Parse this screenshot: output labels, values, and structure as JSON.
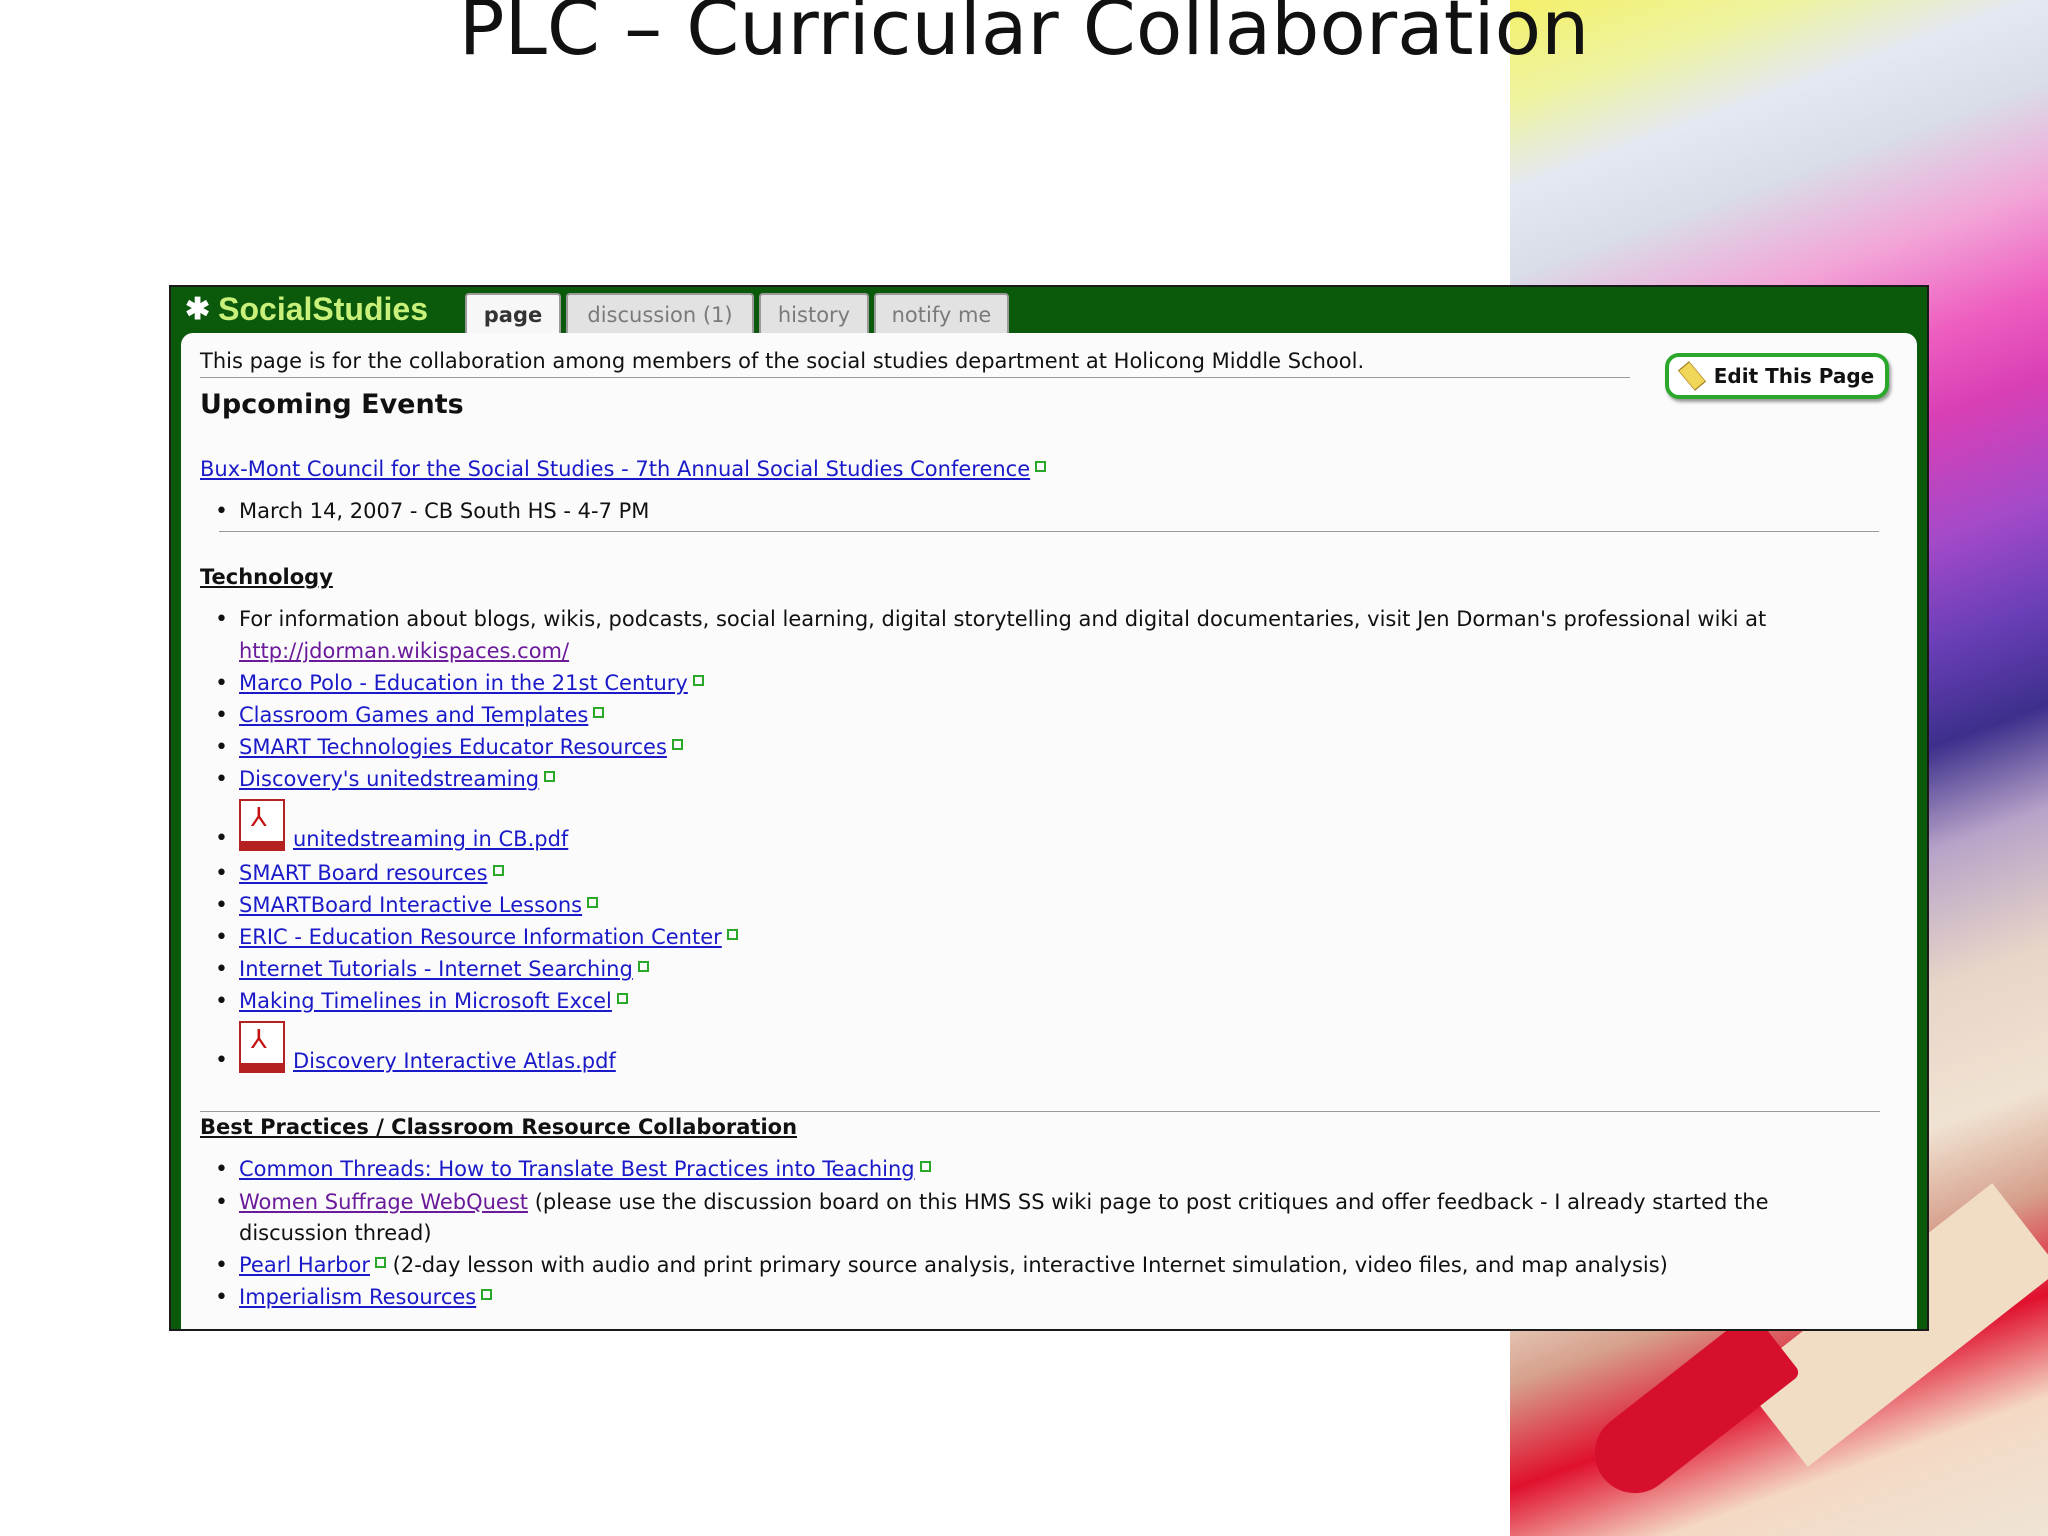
{
  "slide": {
    "title": "PLC – Curricular Collaboration"
  },
  "wiki": {
    "brand": "SocialStudies",
    "tabs": [
      "page",
      "discussion (1)",
      "history",
      "notify me"
    ],
    "edit_button": "Edit This Page",
    "intro": "This page is for the collaboration among members of the social studies department at Holicong Middle School.",
    "upcoming": {
      "heading": "Upcoming Events",
      "link": "Bux-Mont Council for the Social Studies - 7th Annual Social Studies Conference",
      "detail": "March 14, 2007 - CB South HS - 4-7 PM"
    },
    "technology": {
      "heading": "Technology",
      "info_text": "For information about blogs, wikis, podcasts, social learning, digital storytelling and digital documentaries, visit Jen Dorman's professional wiki at",
      "info_link": "http://jdorman.wikispaces.com/",
      "links": [
        "Marco Polo - Education in the 21st Century",
        "Classroom Games and Templates",
        "SMART Technologies Educator Resources",
        "Discovery's unitedstreaming",
        "unitedstreaming in CB.pdf",
        "SMART Board resources",
        "SMARTBoard Interactive Lessons",
        "ERIC - Education Resource Information Center",
        "Internet Tutorials - Internet Searching",
        "Making Timelines in Microsoft Excel",
        "Discovery Interactive Atlas.pdf"
      ]
    },
    "best": {
      "heading": "Best Practices / Classroom Resource Collaboration",
      "item1": "Common Threads: How to Translate Best Practices into Teaching",
      "item2_link": "Women Suffrage WebQuest",
      "item2_text": "(please use the discussion board on this HMS SS wiki page to post critiques and offer feedback - I already started the",
      "item2_text_cont": "discussion thread)",
      "item3_link": "Pearl Harbor",
      "item3_text": "(2-day lesson with audio and print primary source analysis, interactive Internet simulation, video files, and map analysis)",
      "item4": "Imperialism Resources"
    }
  }
}
